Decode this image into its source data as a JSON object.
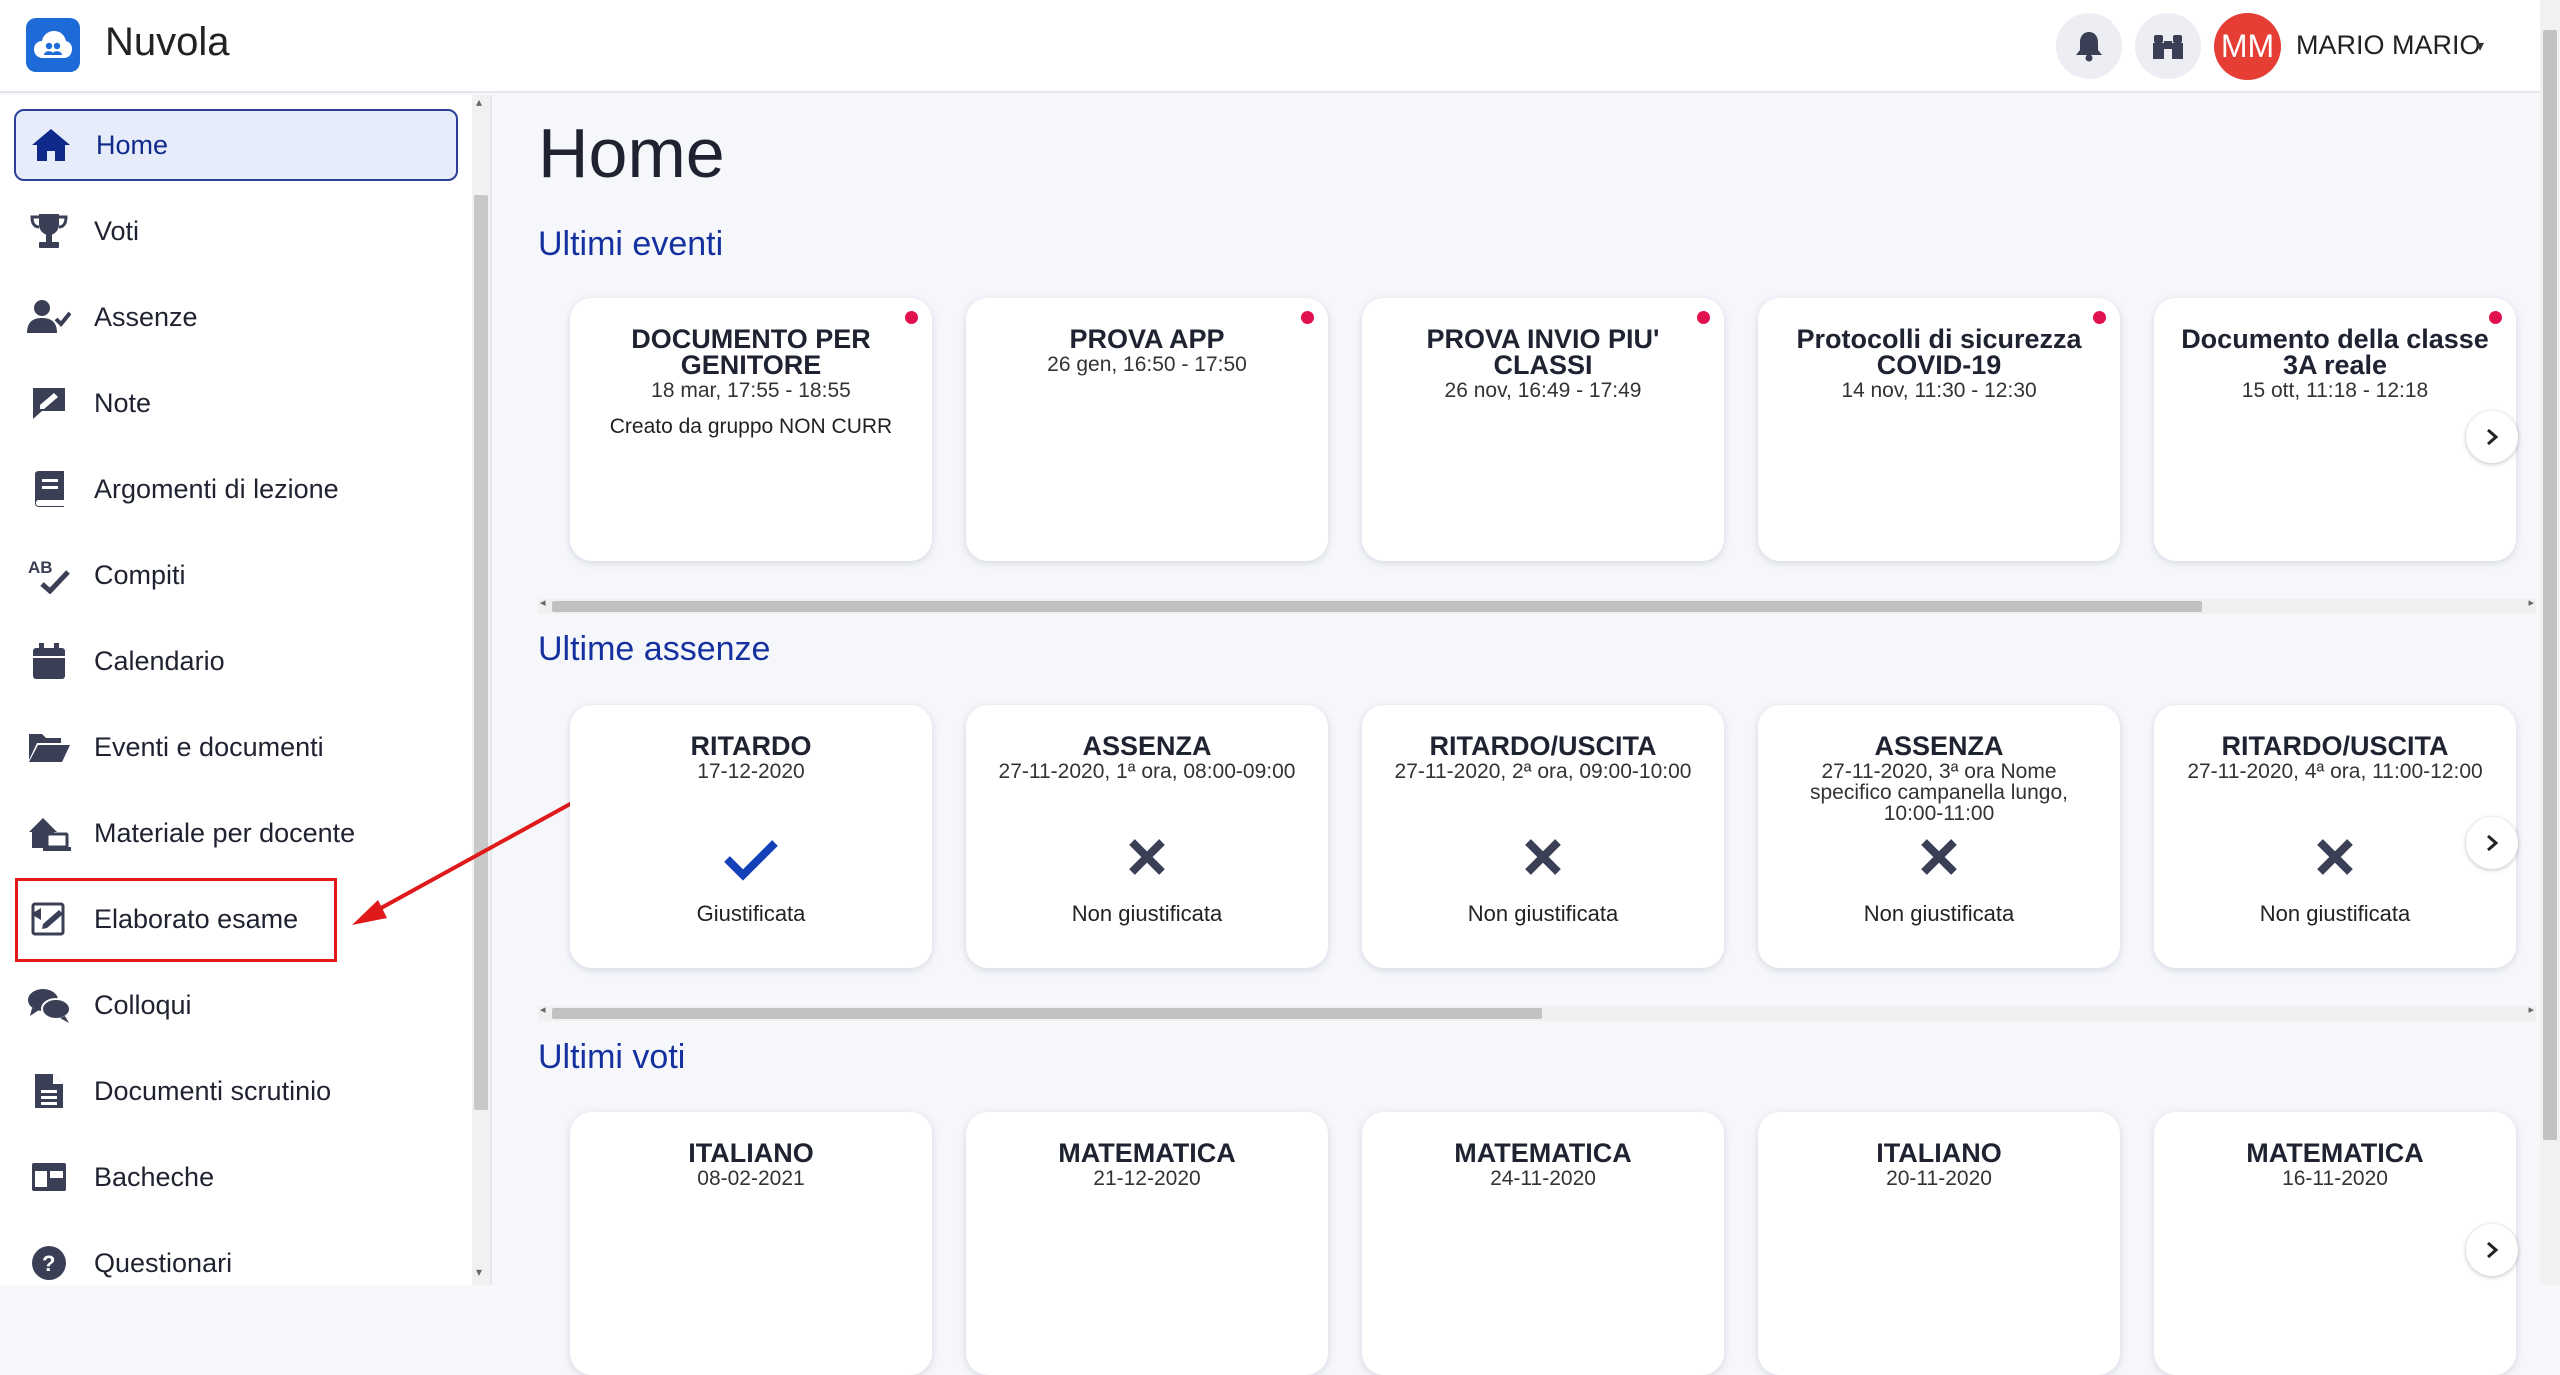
{
  "app": {
    "title": "Nuvola"
  },
  "user": {
    "initials": "MM",
    "name": "MARIO MARIO",
    "caret": "▾"
  },
  "sidebar": {
    "items": [
      {
        "label": "Home",
        "icon": "home-icon"
      },
      {
        "label": "Voti",
        "icon": "trophy-icon"
      },
      {
        "label": "Assenze",
        "icon": "user-check-icon"
      },
      {
        "label": "Note",
        "icon": "note-icon"
      },
      {
        "label": "Argomenti di lezione",
        "icon": "book-icon"
      },
      {
        "label": "Compiti",
        "icon": "spellcheck-icon"
      },
      {
        "label": "Calendario",
        "icon": "calendar-icon"
      },
      {
        "label": "Eventi e documenti",
        "icon": "folder-open-icon"
      },
      {
        "label": "Materiale per docente",
        "icon": "house-laptop-icon"
      },
      {
        "label": "Elaborato esame",
        "icon": "exam-document-icon"
      },
      {
        "label": "Colloqui",
        "icon": "comments-icon"
      },
      {
        "label": "Documenti scrutinio",
        "icon": "file-text-icon"
      },
      {
        "label": "Bacheche",
        "icon": "board-icon"
      },
      {
        "label": "Questionari",
        "icon": "question-circle-icon"
      }
    ]
  },
  "main": {
    "title": "Home",
    "sections": {
      "eventi": {
        "title": "Ultimi eventi",
        "cards": [
          {
            "title": "DOCUMENTO PER GENITORE",
            "sub": "18 mar, 17:55 - 18:55",
            "extra": "Creato da gruppo NON CURR"
          },
          {
            "title": "PROVA APP",
            "sub": "26 gen, 16:50 - 17:50",
            "extra": ""
          },
          {
            "title": "PROVA INVIO PIU' CLASSI",
            "sub": "26 nov, 16:49 - 17:49",
            "extra": ""
          },
          {
            "title": "Protocolli di sicurezza COVID-19",
            "sub": "14 nov, 11:30 - 12:30",
            "extra": ""
          },
          {
            "title": "Documento della classe 3A reale",
            "sub": "15 ott, 11:18 - 12:18",
            "extra": ""
          }
        ]
      },
      "assenze": {
        "title": "Ultime assenze",
        "cards": [
          {
            "title": "RITARDO",
            "sub": "17-12-2020",
            "status": "Giustificata",
            "status_icon": "check-icon"
          },
          {
            "title": "ASSENZA",
            "sub": "27-11-2020, 1ª ora, 08:00-09:00",
            "status": "Non giustificata",
            "status_icon": "x-icon"
          },
          {
            "title": "RITARDO/USCITA",
            "sub": "27-11-2020, 2ª ora, 09:00-10:00",
            "status": "Non giustificata",
            "status_icon": "x-icon"
          },
          {
            "title": "ASSENZA",
            "sub": "27-11-2020, 3ª ora Nome specifico campanella lungo, 10:00-11:00",
            "status": "Non giustificata",
            "status_icon": "x-icon"
          },
          {
            "title": "RITARDO/USCITA",
            "sub": "27-11-2020, 4ª ora, 11:00-12:00",
            "status": "Non giustificata",
            "status_icon": "x-icon"
          }
        ]
      },
      "voti": {
        "title": "Ultimi voti",
        "cards": [
          {
            "title": "ITALIANO",
            "sub": "08-02-2021"
          },
          {
            "title": "MATEMATICA",
            "sub": "21-12-2020"
          },
          {
            "title": "MATEMATICA",
            "sub": "24-11-2020"
          },
          {
            "title": "ITALIANO",
            "sub": "20-11-2020"
          },
          {
            "title": "MATEMATICA",
            "sub": "16-11-2020"
          }
        ]
      }
    }
  },
  "colors": {
    "accent": "#1531a0",
    "logo": "#1e6ad8",
    "avatar": "#e63d35",
    "event_dot": "#e0114e",
    "icon": "#3a3f55",
    "annotation": "#e0191a"
  }
}
